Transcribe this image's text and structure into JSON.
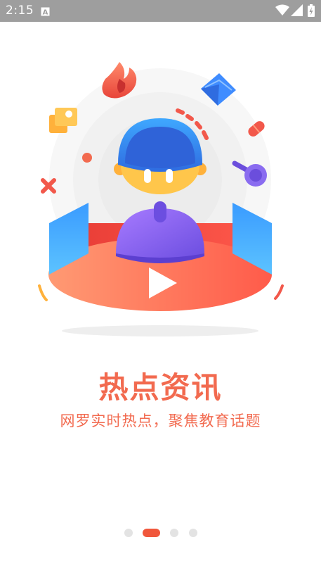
{
  "status_bar": {
    "time": "2:15",
    "notification_icon": "a-icon",
    "icons": [
      "wifi-icon",
      "cell-signal-icon",
      "battery-charging-icon"
    ]
  },
  "onboarding": {
    "title": "热点资讯",
    "subtitle": "网罗实时热点，聚焦教育话题",
    "page_indicator": {
      "total": 4,
      "active_index": 1
    }
  },
  "colors": {
    "accent": "#f26a4f",
    "indicator_active": "#f0573c",
    "indicator_inactive": "#e3e3e3",
    "status_bar": "#9e9e9e"
  }
}
